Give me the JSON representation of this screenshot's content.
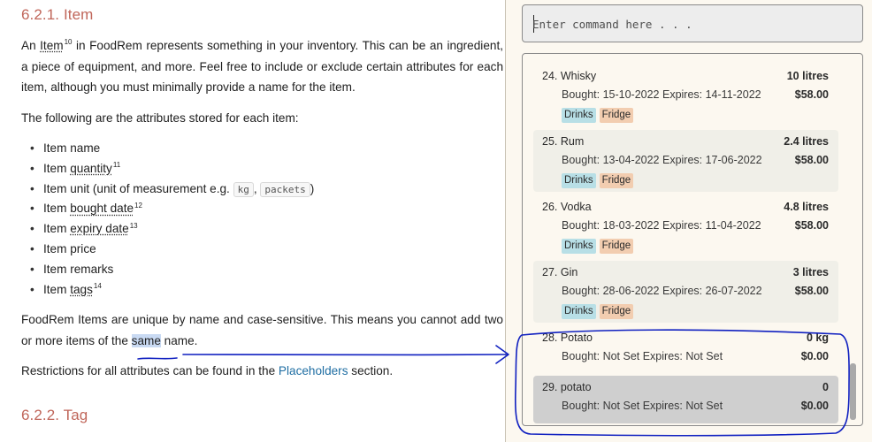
{
  "doc": {
    "heading_item": "6.2.1. Item",
    "p1": {
      "before": "An ",
      "term": "Item",
      "term_fn": "10",
      "after": " in FoodRem represents something in your inventory. This can be an ingredient, a piece of equipment, and more. Feel free to include or exclude certain attributes for each item, although you must minimally provide a name for the item."
    },
    "p2": "The following are the attributes stored for each item:",
    "attributes": [
      {
        "text": "Item name"
      },
      {
        "prefix": "Item ",
        "term": "quantity",
        "fn": "11"
      },
      {
        "prefix": "Item unit (unit of measurement e.g. ",
        "code1": "kg",
        "sep": ", ",
        "code2": "packets",
        "suffix": ")"
      },
      {
        "prefix": "Item ",
        "term": "bought date",
        "fn": "12"
      },
      {
        "prefix": "Item ",
        "term": "expiry date",
        "fn": "13"
      },
      {
        "text": "Item price"
      },
      {
        "text": "Item remarks"
      },
      {
        "prefix": "Item ",
        "term": "tags",
        "fn": "14"
      }
    ],
    "p3": {
      "before": "FoodRem Items are unique by name and case-sensitive. This means you cannot add two or more items of the ",
      "highlight": "same",
      "after": " name."
    },
    "p4": {
      "before": "Restrictions for all attributes can be found in the ",
      "link": "Placeholders",
      "after": " section."
    },
    "heading_tag": "6.2.2. Tag"
  },
  "app": {
    "command_placeholder": "Enter command here . . .",
    "items": [
      {
        "name": "24. Whisky",
        "dates": "Bought: 15-10-2022  Expires: 14-11-2022",
        "qty": "10 litres",
        "price": "$58.00",
        "tags": [
          "Drinks",
          "Fridge"
        ]
      },
      {
        "name": "25. Rum",
        "dates": "Bought: 13-04-2022  Expires: 17-06-2022",
        "qty": "2.4 litres",
        "price": "$58.00",
        "tags": [
          "Drinks",
          "Fridge"
        ]
      },
      {
        "name": "26. Vodka",
        "dates": "Bought: 18-03-2022  Expires: 11-04-2022",
        "qty": "4.8 litres",
        "price": "$58.00",
        "tags": [
          "Drinks",
          "Fridge"
        ]
      },
      {
        "name": "27. Gin",
        "dates": "Bought: 28-06-2022  Expires: 26-07-2022",
        "qty": "3 litres",
        "price": "$58.00",
        "tags": [
          "Drinks",
          "Fridge"
        ]
      },
      {
        "name": "28. Potato",
        "dates": "Bought: Not Set  Expires: Not Set",
        "qty": "0 kg",
        "price": "$0.00",
        "tags": []
      },
      {
        "name": "29. potato",
        "dates": "Bought: Not Set  Expires: Not Set",
        "qty": "0",
        "price": "$0.00",
        "tags": []
      }
    ]
  },
  "colors": {
    "heading": "#c0665a",
    "link": "#1f6ea3",
    "highlight": "#c9daf3",
    "tag_drinks": "#b8dfe6",
    "tag_fridge": "#f2cdb0",
    "selected_card": "#cfcfcf",
    "annotation_ink": "#1020c0"
  }
}
